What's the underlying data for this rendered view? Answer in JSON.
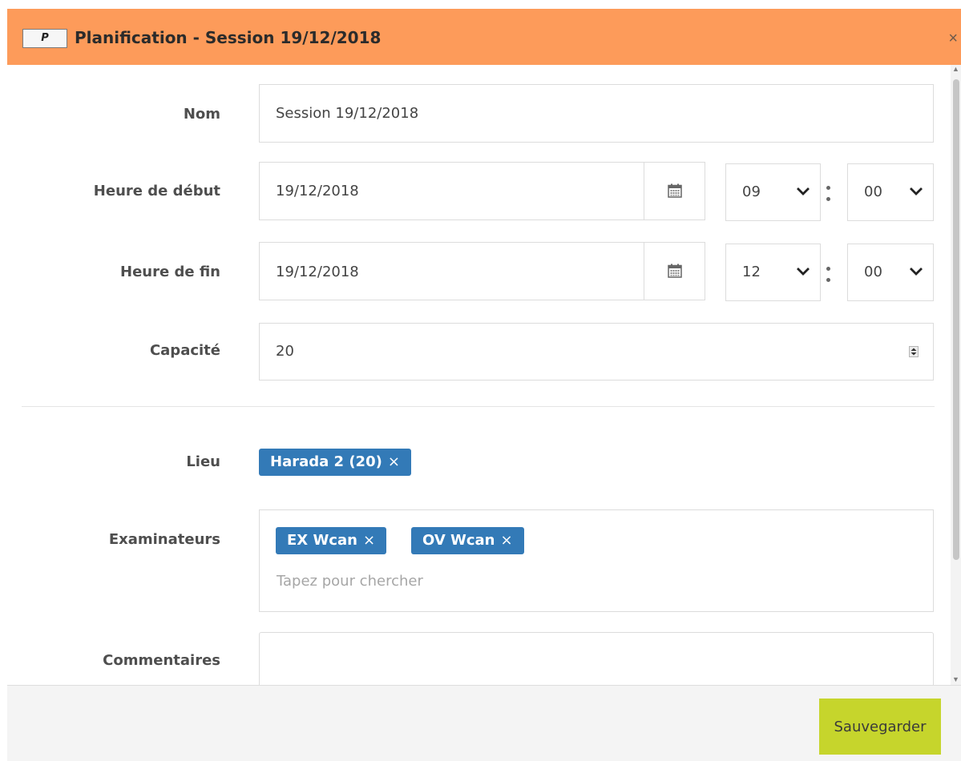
{
  "header": {
    "badge": "P",
    "title": "Planification - Session 19/12/2018",
    "close_glyph": "×",
    "background_color": "#fd9b5a"
  },
  "form": {
    "nom": {
      "label": "Nom",
      "value": "Session 19/12/2018"
    },
    "heure_debut": {
      "label": "Heure de début",
      "date": "19/12/2018",
      "hour": "09",
      "minute": "00",
      "calendar_icon": "calendar-icon"
    },
    "heure_fin": {
      "label": "Heure de fin",
      "date": "19/12/2018",
      "hour": "12",
      "minute": "00",
      "calendar_icon": "calendar-icon"
    },
    "capacite": {
      "label": "Capacité",
      "value": "20"
    },
    "lieu": {
      "label": "Lieu",
      "tags": [
        {
          "text": "Harada 2 (20)",
          "remove": "×"
        }
      ]
    },
    "examinateurs": {
      "label": "Examinateurs",
      "tags": [
        {
          "text": "EX Wcan",
          "remove": "×"
        },
        {
          "text": "OV Wcan",
          "remove": "×"
        }
      ],
      "placeholder": "Tapez pour chercher"
    },
    "commentaires": {
      "label": "Commentaires",
      "value": ""
    }
  },
  "footer": {
    "save_label": "Sauvegarder",
    "save_color": "#c6d52c"
  },
  "colors": {
    "tag": "#337ab7",
    "label": "#4e4e4e"
  }
}
